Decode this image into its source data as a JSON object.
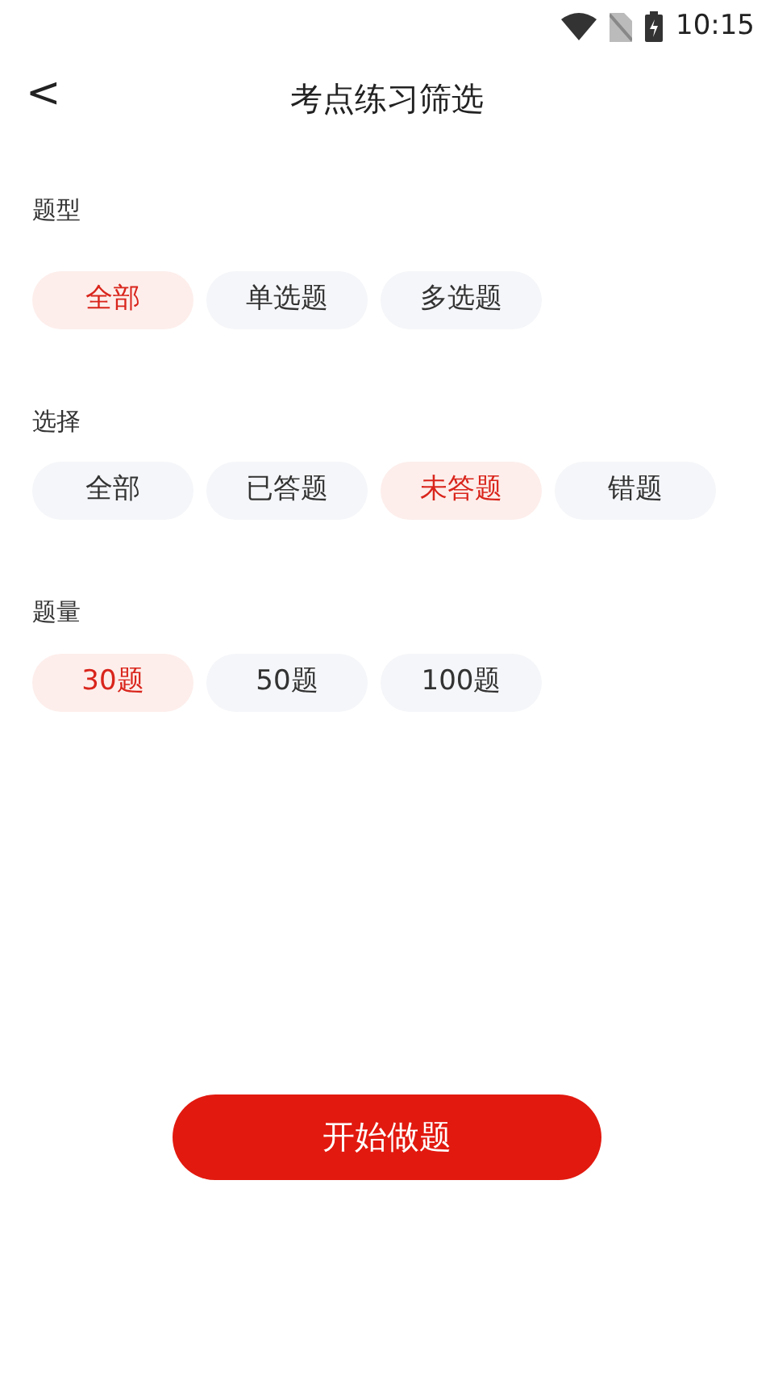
{
  "status_bar": {
    "time": "10:15"
  },
  "header": {
    "back": "<",
    "title": "考点练习筛选"
  },
  "sections": [
    {
      "label": "题型",
      "options": [
        {
          "label": "全部",
          "selected": true
        },
        {
          "label": "单选题",
          "selected": false
        },
        {
          "label": "多选题",
          "selected": false
        }
      ]
    },
    {
      "label": "选择",
      "options": [
        {
          "label": "全部",
          "selected": false
        },
        {
          "label": "已答题",
          "selected": false
        },
        {
          "label": "未答题",
          "selected": true
        },
        {
          "label": "错题",
          "selected": false
        }
      ]
    },
    {
      "label": "题量",
      "options": [
        {
          "label": "30题",
          "selected": true
        },
        {
          "label": "50题",
          "selected": false
        },
        {
          "label": "100题",
          "selected": false
        }
      ]
    }
  ],
  "start_button": "开始做题"
}
